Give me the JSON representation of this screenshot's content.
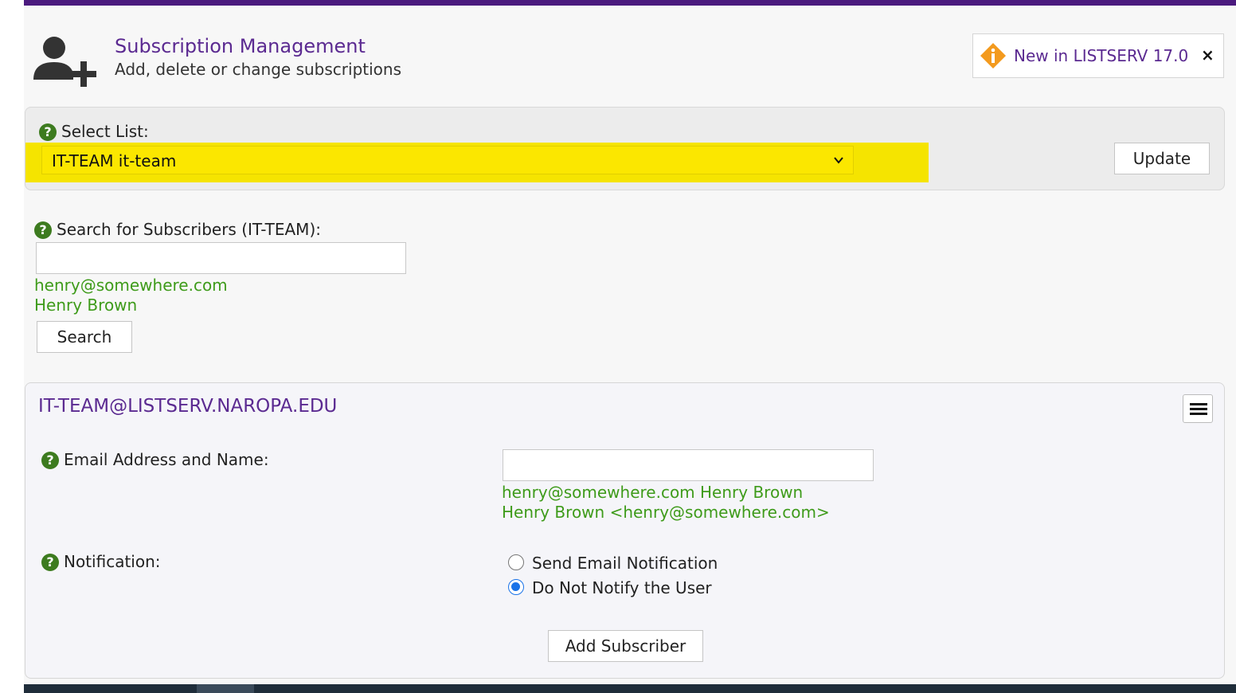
{
  "header": {
    "title": "Subscription Management",
    "subtitle": "Add, delete or change subscriptions",
    "icon": "add-user-icon"
  },
  "news": {
    "label": "New in LISTSERV 17.0",
    "close_label": "×",
    "icon": "info-diamond-icon"
  },
  "select_list": {
    "label": "Select List:",
    "selected": "IT-TEAM it-team",
    "update_label": "Update"
  },
  "search": {
    "label": "Search for Subscribers (IT-TEAM):",
    "value": "",
    "hint_email": "henry@somewhere.com",
    "hint_name": "Henry Brown",
    "button_label": "Search"
  },
  "subscriber_form": {
    "title": "IT-TEAM@LISTSERV.NAROPA.EDU",
    "email_label": "Email Address and Name:",
    "email_value": "",
    "email_hint1": "henry@somewhere.com Henry Brown",
    "email_hint2": "Henry Brown <henry@somewhere.com>",
    "notification_label": "Notification:",
    "notification_options": [
      {
        "label": "Send Email Notification",
        "checked": false
      },
      {
        "label": "Do Not Notify the User",
        "checked": true
      }
    ],
    "add_button_label": "Add Subscriber"
  },
  "help_glyph": "?",
  "colors": {
    "accent_purple": "#5b2a91",
    "top_bar": "#4b1a7e",
    "hint_green": "#3e9b1a",
    "highlight_yellow": "#f5e400",
    "help_green": "#3d7b1f",
    "news_orange": "#f39a1e"
  }
}
